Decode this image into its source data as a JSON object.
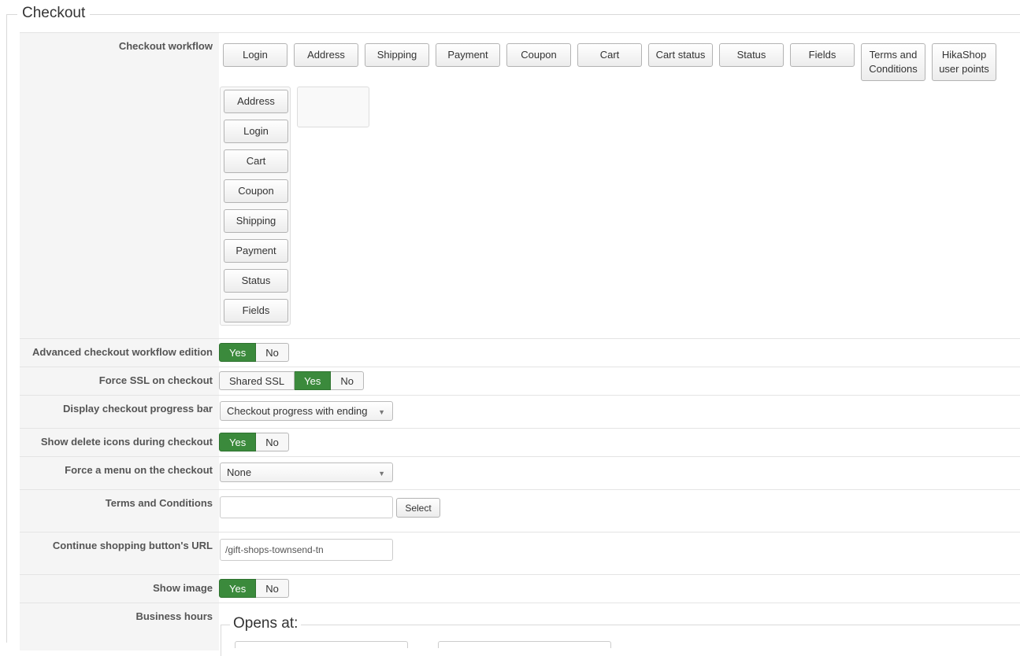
{
  "section": {
    "title": "Checkout"
  },
  "workflow": {
    "label": "Checkout workflow",
    "palette": [
      "Login",
      "Address",
      "Shipping",
      "Payment",
      "Coupon",
      "Cart",
      "Cart status",
      "Status",
      "Fields"
    ],
    "palette_terms": [
      "Terms and",
      "Conditions"
    ],
    "palette_points": [
      "HikaShop",
      "user points"
    ],
    "steps": [
      "Address",
      "Login",
      "Cart",
      "Coupon",
      "Shipping",
      "Payment",
      "Status",
      "Fields"
    ]
  },
  "advanced": {
    "label": "Advanced checkout workflow edition",
    "yes": "Yes",
    "no": "No",
    "selected": "Yes"
  },
  "ssl": {
    "label": "Force SSL on checkout",
    "shared": "Shared SSL",
    "yes": "Yes",
    "no": "No",
    "selected": "Yes"
  },
  "progress": {
    "label": "Display checkout progress bar",
    "value": "Checkout progress with ending"
  },
  "delete_icons": {
    "label": "Show delete icons during checkout",
    "yes": "Yes",
    "no": "No",
    "selected": "Yes"
  },
  "menu": {
    "label": "Force a menu on the checkout",
    "value": "None"
  },
  "terms": {
    "label": "Terms and Conditions",
    "value": "",
    "select_label": "Select"
  },
  "continue_url": {
    "label": "Continue shopping button's URL",
    "value": "/gift-shops-townsend-tn"
  },
  "show_image": {
    "label": "Show image",
    "yes": "Yes",
    "no": "No",
    "selected": "Yes"
  },
  "hours": {
    "label": "Business hours",
    "opens_title": "Opens at:"
  },
  "colors": {
    "active_green": "#3b8a3c",
    "label_bg": "#f5f5f5"
  }
}
